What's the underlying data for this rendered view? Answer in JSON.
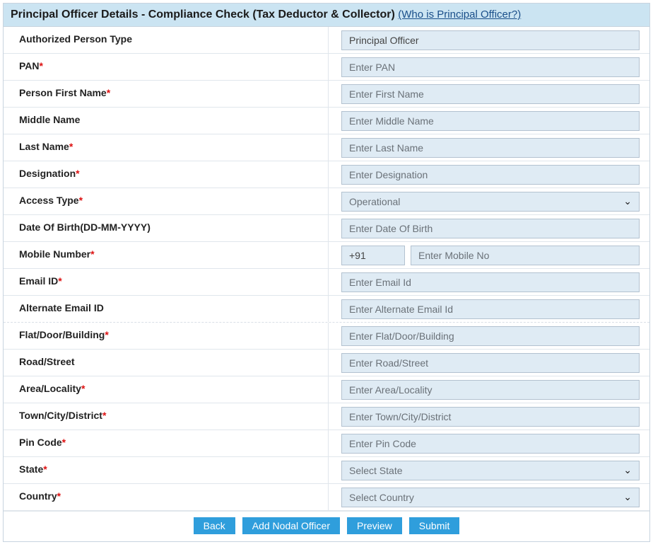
{
  "header": {
    "title": "Principal Officer Details - Compliance Check (Tax Deductor & Collector)",
    "help_link": "(Who is Principal Officer?)"
  },
  "fields": {
    "authorized_person_type": {
      "label": "Authorized Person Type",
      "required": false,
      "value": "Principal Officer"
    },
    "pan": {
      "label": "PAN",
      "required": true,
      "placeholder": "Enter PAN"
    },
    "first_name": {
      "label": "Person First Name",
      "required": true,
      "placeholder": "Enter First Name"
    },
    "middle_name": {
      "label": "Middle Name",
      "required": false,
      "placeholder": "Enter Middle Name"
    },
    "last_name": {
      "label": "Last Name",
      "required": true,
      "placeholder": "Enter Last Name"
    },
    "designation": {
      "label": "Designation",
      "required": true,
      "placeholder": "Enter Designation"
    },
    "access_type": {
      "label": "Access Type",
      "required": true,
      "value": "Operational"
    },
    "dob": {
      "label": "Date Of Birth(DD-MM-YYYY)",
      "required": false,
      "placeholder": "Enter Date Of Birth"
    },
    "mobile": {
      "label": "Mobile Number",
      "required": true,
      "prefix": "+91",
      "placeholder": "Enter Mobile No"
    },
    "email": {
      "label": "Email ID",
      "required": true,
      "placeholder": "Enter Email Id"
    },
    "alt_email": {
      "label": "Alternate Email ID",
      "required": false,
      "placeholder": "Enter Alternate Email Id"
    },
    "flat": {
      "label": "Flat/Door/Building",
      "required": true,
      "placeholder": "Enter Flat/Door/Building"
    },
    "road": {
      "label": "Road/Street",
      "required": false,
      "placeholder": "Enter Road/Street"
    },
    "area": {
      "label": "Area/Locality",
      "required": true,
      "placeholder": "Enter Area/Locality"
    },
    "town": {
      "label": "Town/City/District",
      "required": true,
      "placeholder": "Enter Town/City/District"
    },
    "pincode": {
      "label": "Pin Code",
      "required": true,
      "placeholder": "Enter Pin Code"
    },
    "state": {
      "label": "State",
      "required": true,
      "value": "Select State"
    },
    "country": {
      "label": "Country",
      "required": true,
      "value": "Select Country"
    }
  },
  "buttons": {
    "back": "Back",
    "add_nodal": "Add Nodal Officer",
    "preview": "Preview",
    "submit": "Submit"
  },
  "required_marker": "*"
}
